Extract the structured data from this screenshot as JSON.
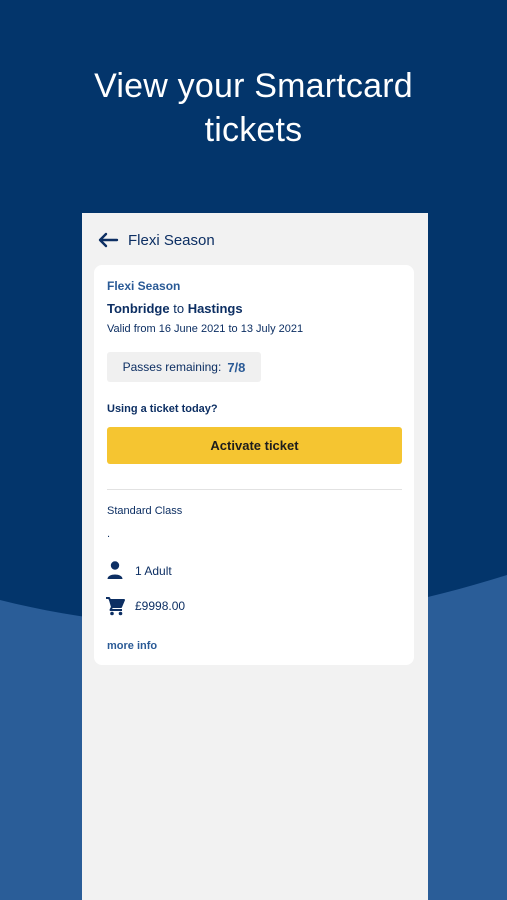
{
  "headline": {
    "line1": "View your Smartcard",
    "line2": "tickets"
  },
  "colors": {
    "primary": "#03356b",
    "wave": "#2a5d98",
    "accent": "#f5c531",
    "screen_bg": "#f2f2f2"
  },
  "appbar": {
    "back_icon": "arrow-left-icon",
    "title": "Flexi Season"
  },
  "ticket": {
    "type": "Flexi Season",
    "origin": "Tonbridge",
    "connector": "to",
    "destination": "Hastings",
    "validity": "Valid from 16 June 2021 to 13 July 2021",
    "passes_label": "Passes remaining:",
    "passes_value": "7/8",
    "prompt": "Using a ticket today?",
    "activate_label": "Activate ticket",
    "class": "Standard Class",
    "dot": ".",
    "passengers": "1 Adult",
    "price": "£9998.00",
    "more_info": "more info"
  },
  "icons": {
    "passenger": "person-icon",
    "price": "cart-icon"
  }
}
